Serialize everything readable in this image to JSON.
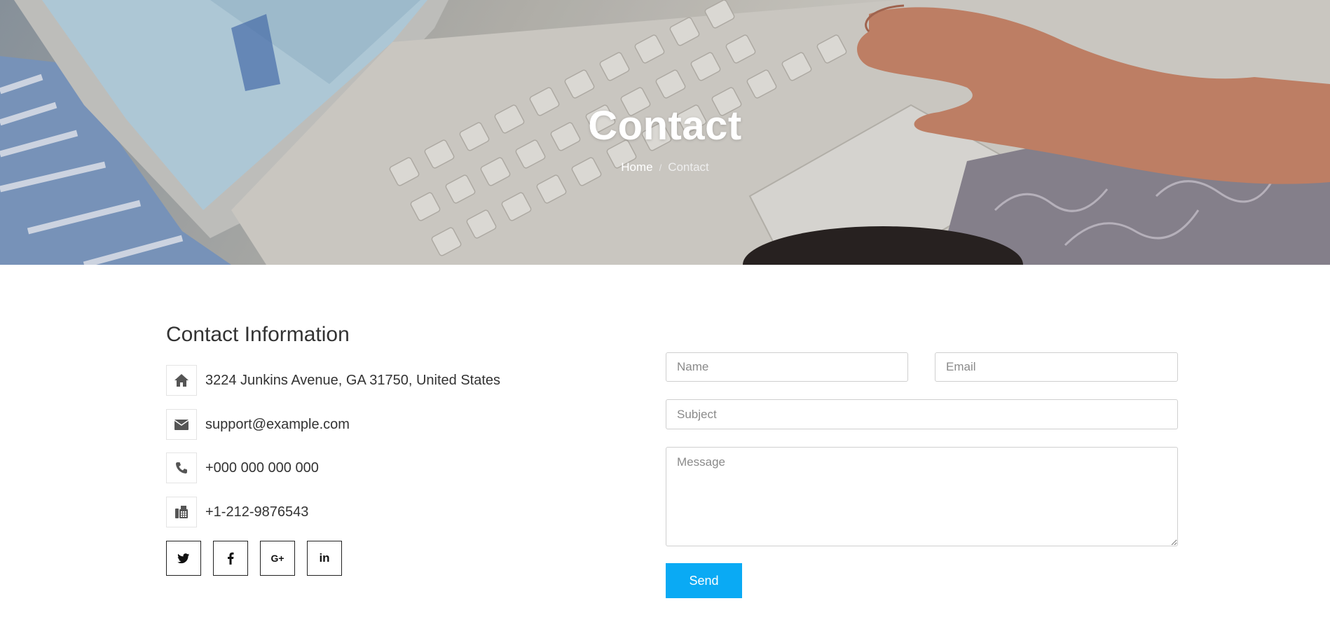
{
  "hero": {
    "title": "Contact",
    "breadcrumb": {
      "home": "Home",
      "separator": "/",
      "current": "Contact"
    }
  },
  "contact_info": {
    "title": "Contact Information",
    "items": [
      {
        "icon": "home-icon",
        "text": "3224 Junkins Avenue, GA 31750, United States"
      },
      {
        "icon": "envelope-icon",
        "text": "support@example.com"
      },
      {
        "icon": "phone-icon",
        "text": "+000 000 000 000"
      },
      {
        "icon": "fax-icon",
        "text": "+1-212-9876543"
      }
    ],
    "social": [
      {
        "icon": "twitter-icon",
        "label": "t"
      },
      {
        "icon": "facebook-icon",
        "label": "f"
      },
      {
        "icon": "google-plus-icon",
        "label": "G+"
      },
      {
        "icon": "linkedin-icon",
        "label": "in"
      }
    ]
  },
  "form": {
    "name_placeholder": "Name",
    "email_placeholder": "Email",
    "subject_placeholder": "Subject",
    "message_placeholder": "Message",
    "send_label": "Send"
  },
  "colors": {
    "accent": "#0aaaf4",
    "hero_text": "#ffffff",
    "body_text": "#333333"
  }
}
